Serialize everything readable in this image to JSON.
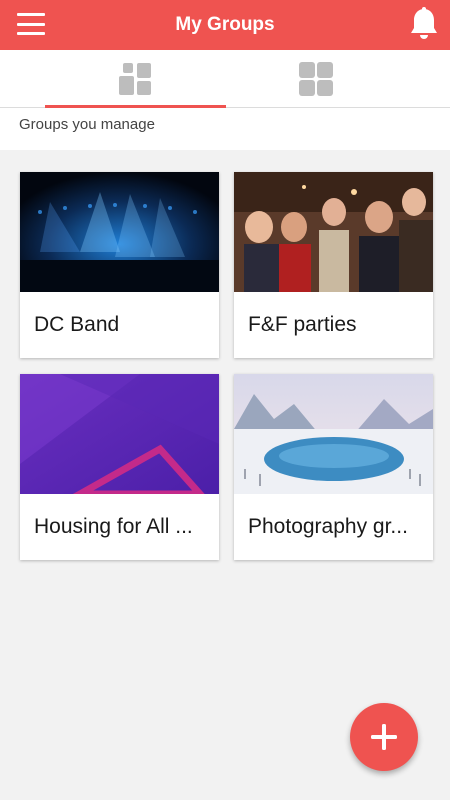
{
  "header": {
    "title": "My Groups",
    "menu_icon": "menu-icon",
    "notification_icon": "bell-icon"
  },
  "tabs": [
    {
      "icon": "dashboard-icon",
      "selected": true
    },
    {
      "icon": "grid-icon",
      "selected": false
    }
  ],
  "section": {
    "label": "Groups you manage"
  },
  "groups": [
    {
      "name": "DC Band",
      "image": "concert-photo"
    },
    {
      "name": "F&F parties",
      "image": "party-photo"
    },
    {
      "name": "Housing for All ...",
      "image": "purple-abstract-photo"
    },
    {
      "name": "Photography gr...",
      "image": "winter-lake-photo"
    }
  ],
  "fab": {
    "icon": "plus-icon"
  },
  "colors": {
    "accent": "#ef5350",
    "background": "#f2f2f2",
    "icon_gray": "#bdbdbd"
  }
}
